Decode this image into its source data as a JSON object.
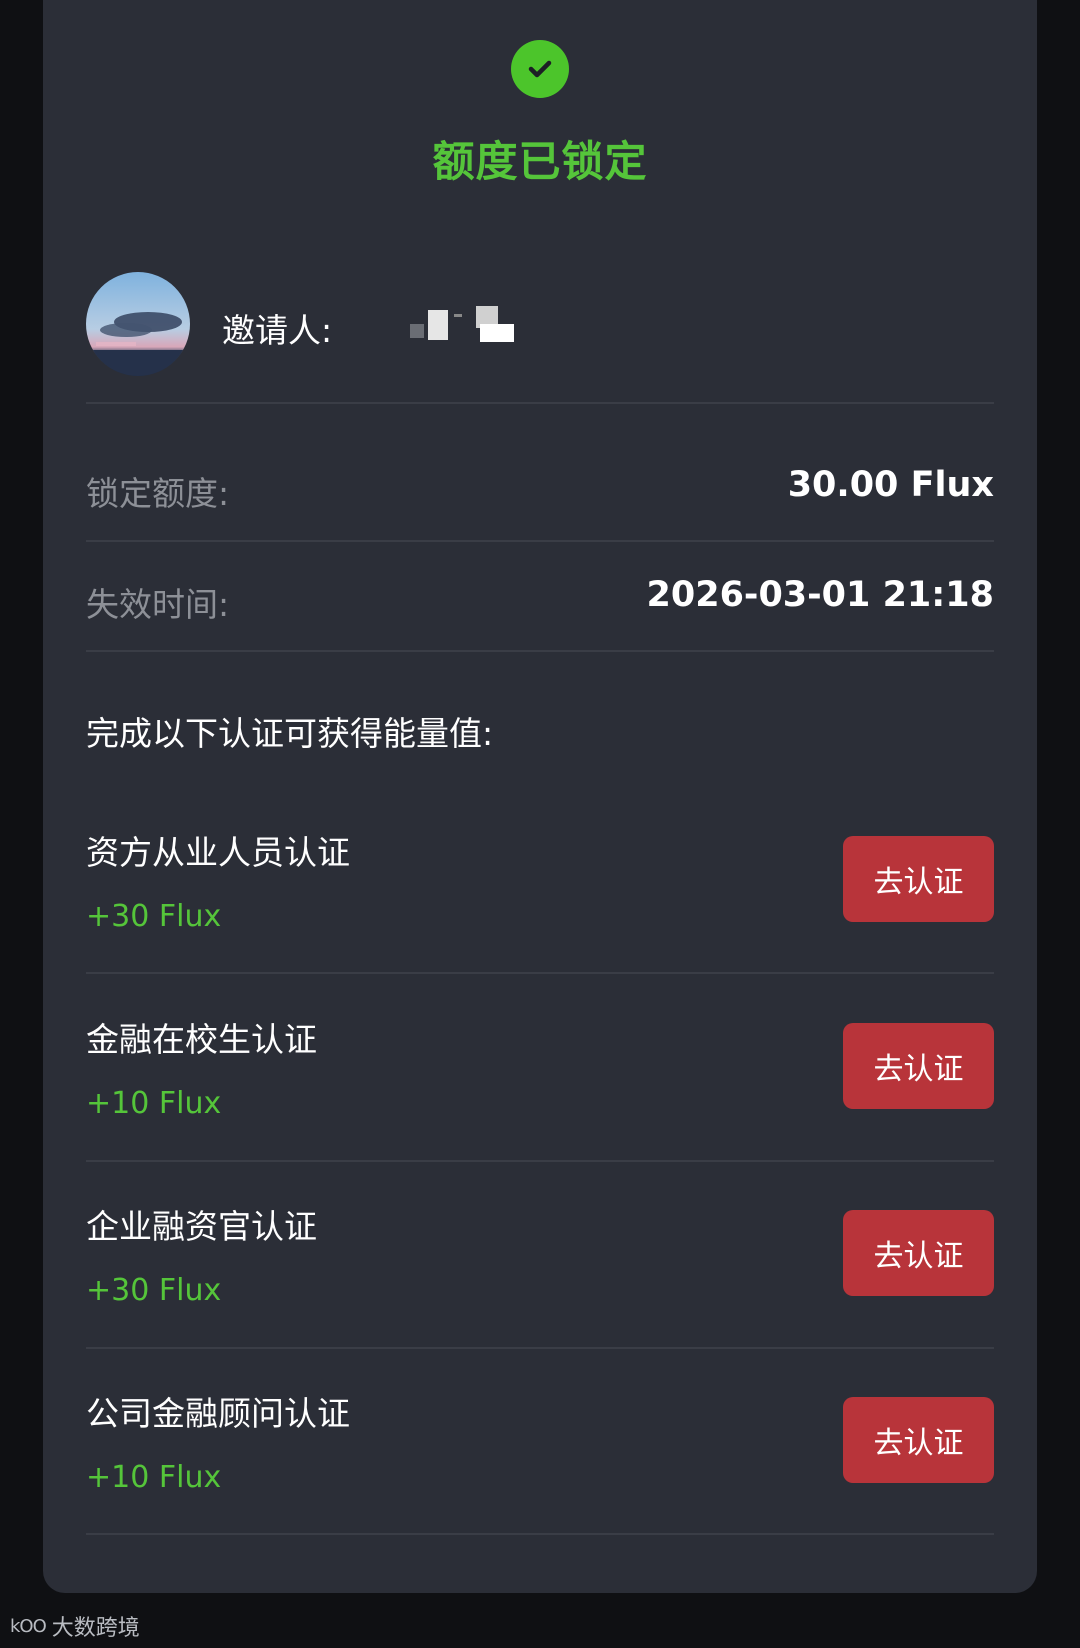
{
  "status": {
    "title": "额度已锁定",
    "icon": "check-circle-icon",
    "accent": "#4cc52b"
  },
  "inviter": {
    "label": "邀请人:"
  },
  "details": {
    "locked_amount_label": "锁定额度:",
    "locked_amount_value": "30.00 Flux",
    "expire_label": "失效时间:",
    "expire_value": "2026-03-01 21:18"
  },
  "section_title": "完成以下认证可获得能量值:",
  "certifications": [
    {
      "name": "资方从业人员认证",
      "reward": "+30 Flux",
      "button": "去认证"
    },
    {
      "name": "金融在校生认证",
      "reward": "+10 Flux",
      "button": "去认证"
    },
    {
      "name": "企业融资官认证",
      "reward": "+30 Flux",
      "button": "去认证"
    },
    {
      "name": "公司金融顾问认证",
      "reward": "+10 Flux",
      "button": "去认证"
    }
  ],
  "colors": {
    "background": "#0f1013",
    "card": "#2b2e37",
    "reward": "#55c53a",
    "button": "#b8343a"
  },
  "watermark": {
    "mark": "kOO",
    "text": "大数跨境"
  }
}
